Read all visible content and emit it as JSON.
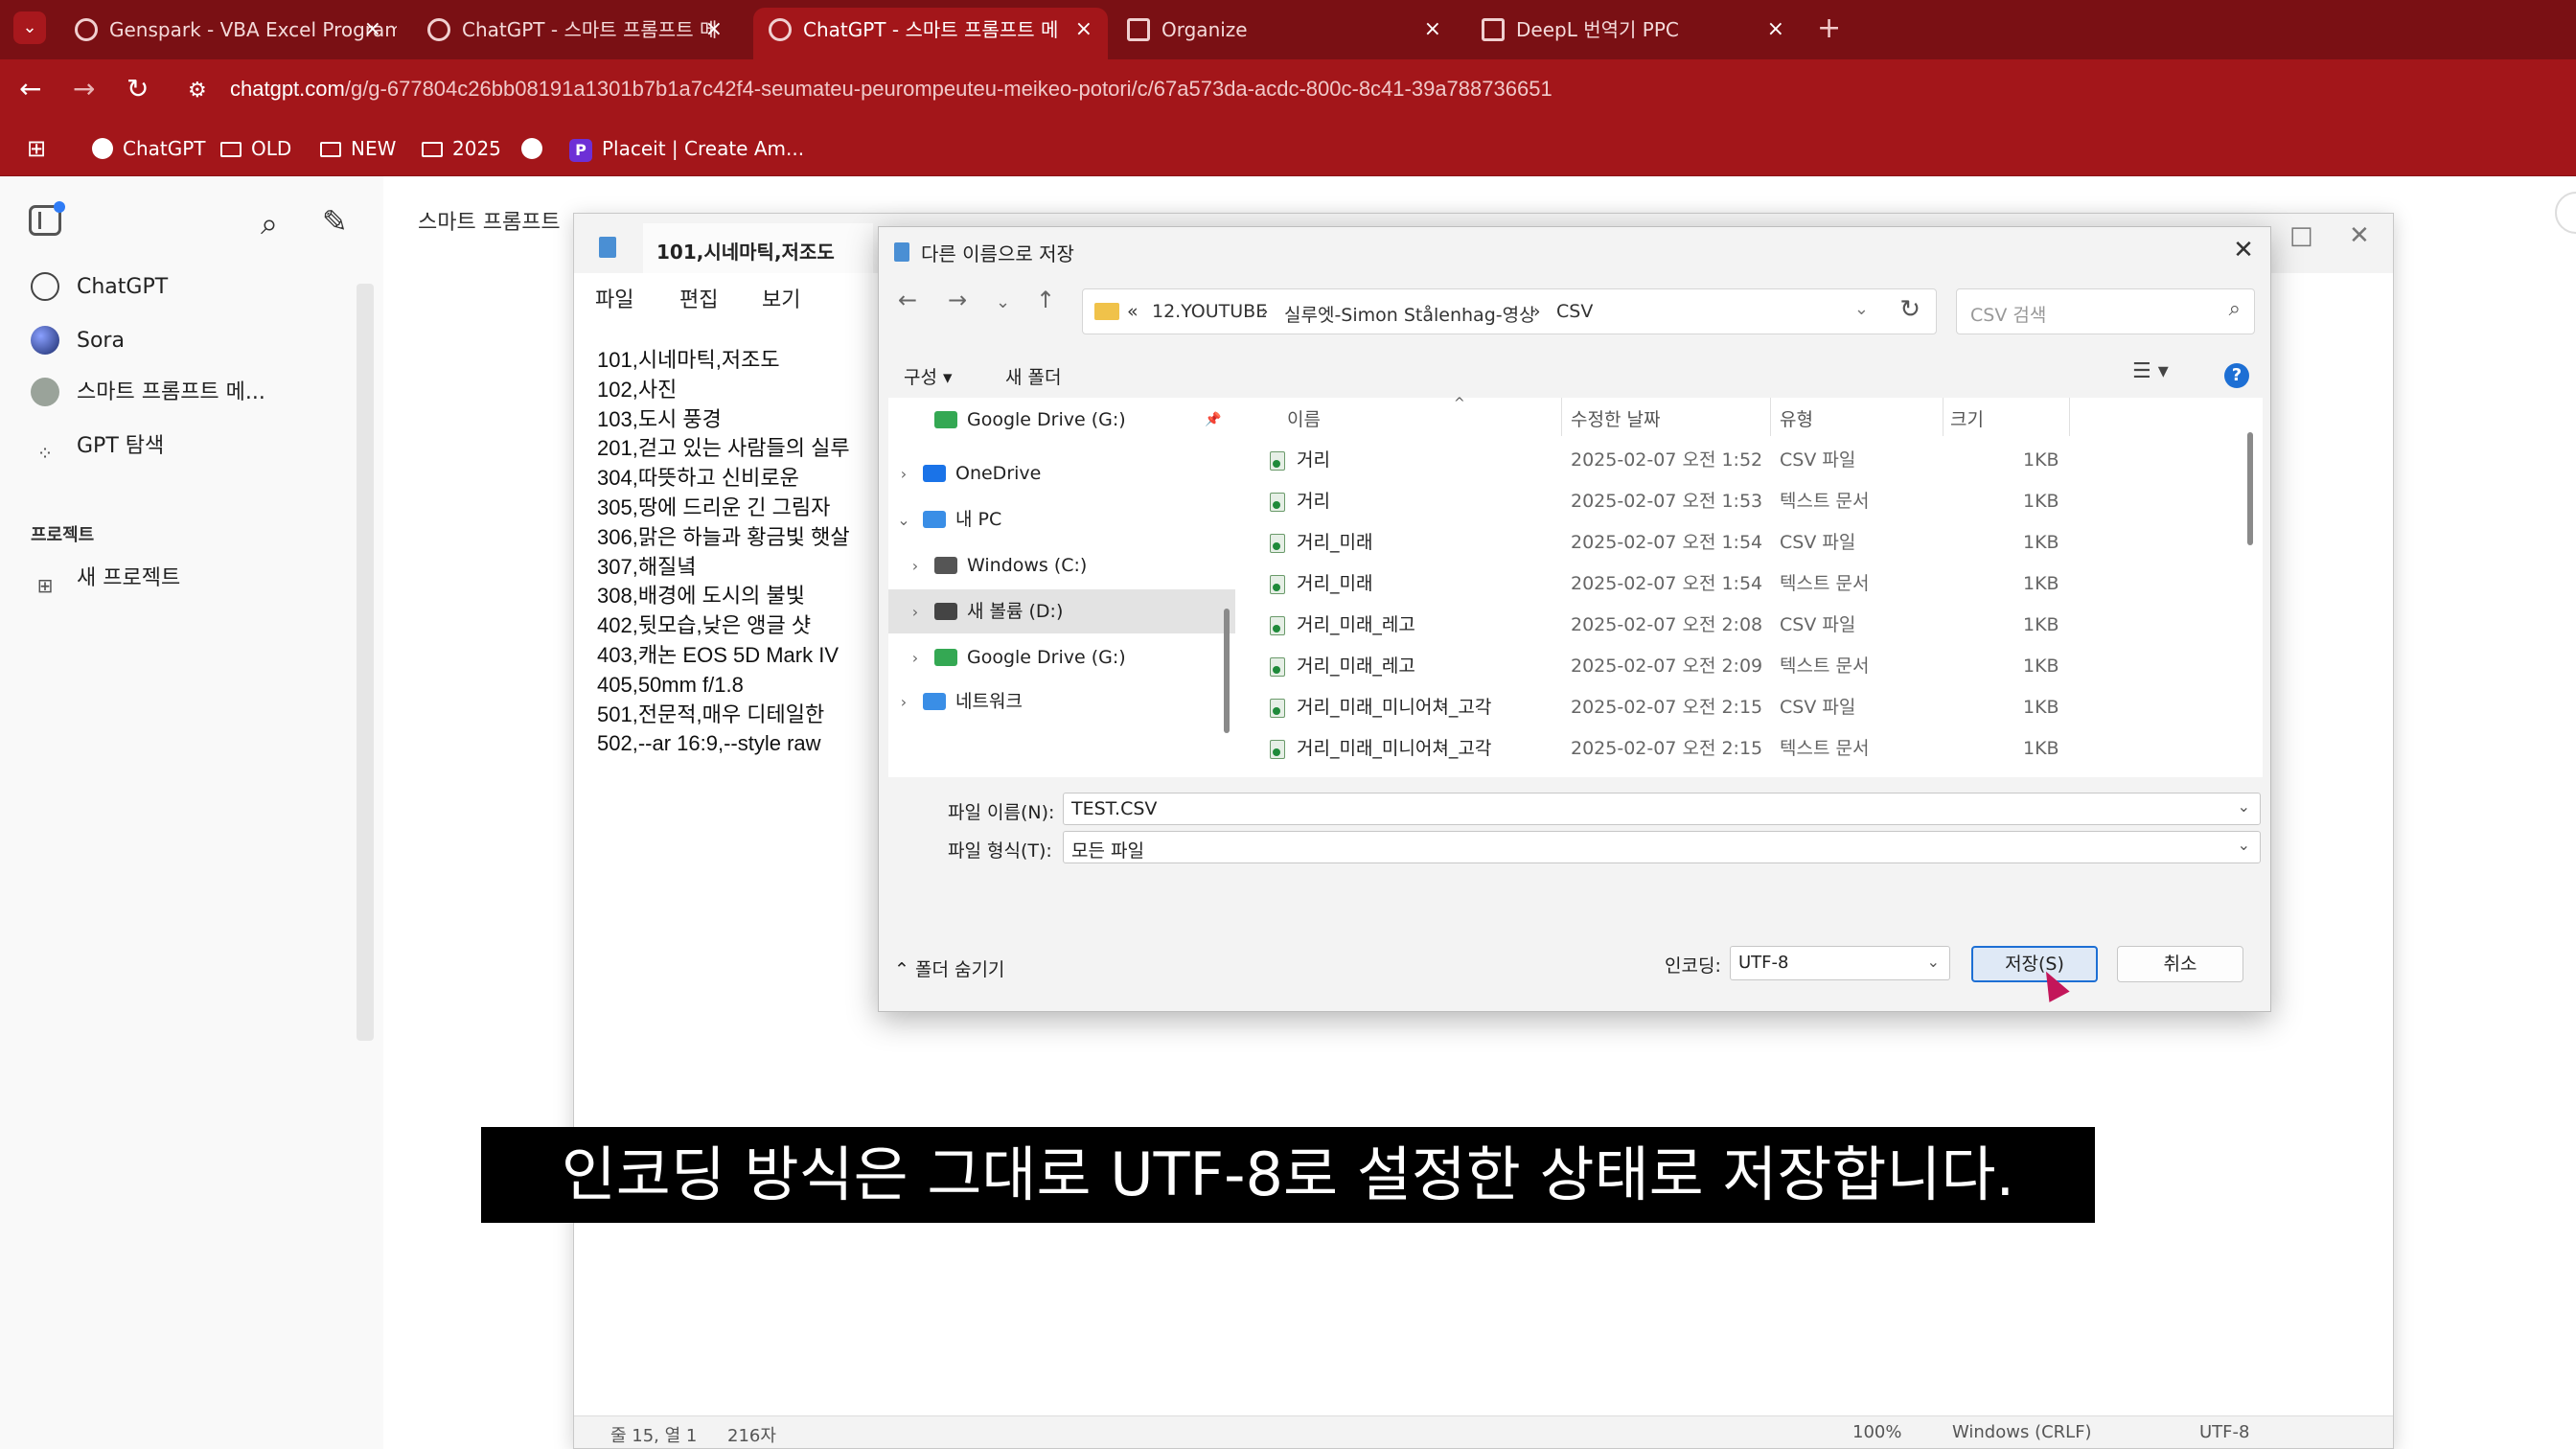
{
  "browser": {
    "tabs": [
      {
        "label": "Genspark - VBA Excel Program",
        "active": false
      },
      {
        "label": "ChatGPT - 스마트 프롬프트 메",
        "active": false
      },
      {
        "label": "ChatGPT - 스마트 프롬프트 메",
        "active": true
      },
      {
        "label": "Organize",
        "active": false
      },
      {
        "label": "DeepL 번역기 PPC",
        "active": false
      }
    ],
    "url_domain": "chatgpt.com",
    "url_path": "/g/g-677804c26bb08191a1301b7b1a7c42f4-seumateu-peurompeuteu-meikeo-potori/c/67a573da-acdc-800c-8c41-39a788736651",
    "bookmarks": [
      "ChatGPT",
      "OLD",
      "NEW",
      "2025",
      "Placeit | Create Am..."
    ]
  },
  "sidebar": {
    "items": [
      {
        "label": "ChatGPT"
      },
      {
        "label": "Sora"
      },
      {
        "label": "스마트 프롬프트 메..."
      },
      {
        "label": "GPT 탐색"
      }
    ],
    "section_title": "프로젝트",
    "new_project": "새 프로젝트"
  },
  "page": {
    "breadcrumb": "스마트 프롬프트"
  },
  "notepad": {
    "tab_title": "101,시네마틱,저조도",
    "menu": [
      "파일",
      "편집",
      "보기"
    ],
    "lines": [
      "101,시네마틱,저조도",
      "102,사진",
      "103,도시 풍경",
      "201,걷고 있는 사람들의 실루",
      "304,따뜻하고 신비로운",
      "305,땅에 드리운 긴 그림자",
      "306,맑은 하늘과 황금빛 햇살",
      "307,해질녘",
      "308,배경에 도시의 불빛",
      "402,뒷모습,낮은 앵글 샷",
      "403,캐논 EOS 5D Mark IV",
      "405,50mm f/1.8",
      "501,전문적,매우 디테일한",
      "502,--ar 16:9,--style raw"
    ],
    "status": {
      "position": "줄 15, 열 1",
      "chars": "216자",
      "zoom": "100%",
      "line_ending": "Windows (CRLF)",
      "encoding": "UTF-8"
    }
  },
  "dialog": {
    "title": "다른 이름으로 저장",
    "path": [
      "12.YOUTUBE",
      "실루엣-Simon Stålenhag-영상",
      "CSV"
    ],
    "search_placeholder": "CSV 검색",
    "toolbar": {
      "organize": "구성 ▾",
      "new_folder": "새 폴더"
    },
    "tree": [
      {
        "label": "Google Drive (G:)",
        "indent": 1,
        "expander": "",
        "icon": "gdrive"
      },
      {
        "label": "OneDrive",
        "indent": 0,
        "expander": "›",
        "icon": "onedrive"
      },
      {
        "label": "내 PC",
        "indent": 0,
        "expander": "⌄",
        "icon": "pc"
      },
      {
        "label": "Windows (C:)",
        "indent": 1,
        "expander": "›",
        "icon": "win"
      },
      {
        "label": "새 볼륨 (D:)",
        "indent": 1,
        "expander": "›",
        "icon": "drive",
        "selected": true
      },
      {
        "label": "Google Drive (G:)",
        "indent": 1,
        "expander": "›",
        "icon": "gdrive"
      },
      {
        "label": "네트워크",
        "indent": 0,
        "expander": "›",
        "icon": "network"
      }
    ],
    "columns": [
      "이름",
      "수정한 날짜",
      "유형",
      "크기"
    ],
    "files": [
      {
        "name": "거리",
        "date": "2025-02-07 오전 1:52",
        "type": "CSV 파일",
        "size": "1KB"
      },
      {
        "name": "거리",
        "date": "2025-02-07 오전 1:53",
        "type": "텍스트 문서",
        "size": "1KB"
      },
      {
        "name": "거리_미래",
        "date": "2025-02-07 오전 1:54",
        "type": "CSV 파일",
        "size": "1KB"
      },
      {
        "name": "거리_미래",
        "date": "2025-02-07 오전 1:54",
        "type": "텍스트 문서",
        "size": "1KB"
      },
      {
        "name": "거리_미래_레고",
        "date": "2025-02-07 오전 2:08",
        "type": "CSV 파일",
        "size": "1KB"
      },
      {
        "name": "거리_미래_레고",
        "date": "2025-02-07 오전 2:09",
        "type": "텍스트 문서",
        "size": "1KB"
      },
      {
        "name": "거리_미래_미니어쳐_고각",
        "date": "2025-02-07 오전 2:15",
        "type": "CSV 파일",
        "size": "1KB"
      },
      {
        "name": "거리_미래_미니어쳐_고각",
        "date": "2025-02-07 오전 2:15",
        "type": "텍스트 문서",
        "size": "1KB"
      }
    ],
    "filename_label": "파일 이름(N):",
    "filename_value": "TEST.CSV",
    "filetype_label": "파일 형식(T):",
    "filetype_value": "모든 파일",
    "hide_folders": "폴더 숨기기",
    "encoding_label": "인코딩:",
    "encoding_value": "UTF-8",
    "save_label": "저장(S)",
    "cancel_label": "취소"
  },
  "subtitle": "인코딩 방식은 그대로 UTF-8로 설정한 상태로 저장합니다.",
  "colors": {
    "chrome": "#a3161a",
    "accent": "#1d6fd4"
  }
}
